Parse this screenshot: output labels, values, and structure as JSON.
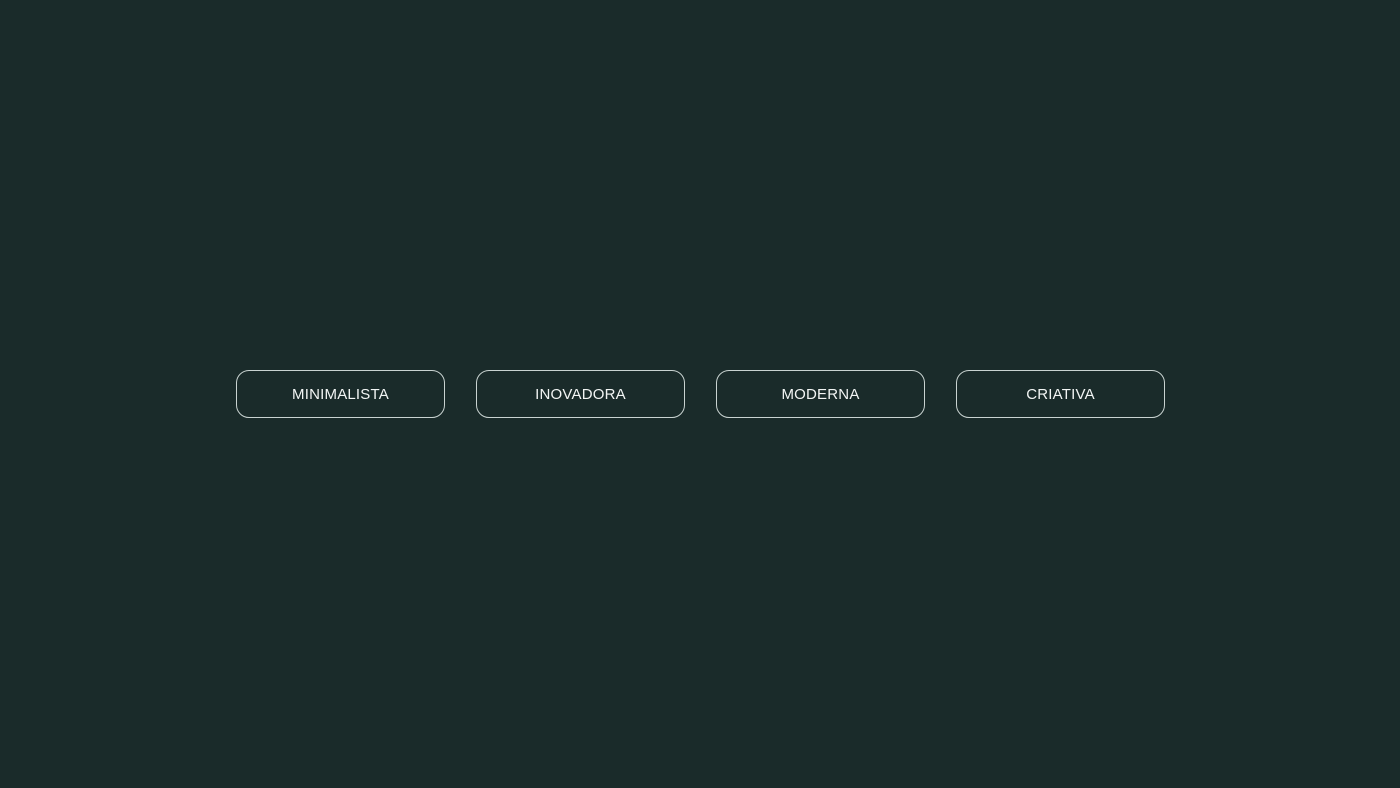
{
  "background_color": "#1a2b2a",
  "border_color": "#c9d3d1",
  "text_color": "#f2f5f4",
  "tags": [
    {
      "label": "MINIMALISTA"
    },
    {
      "label": "INOVADORA"
    },
    {
      "label": "MODERNA"
    },
    {
      "label": "CRIATIVA"
    }
  ]
}
